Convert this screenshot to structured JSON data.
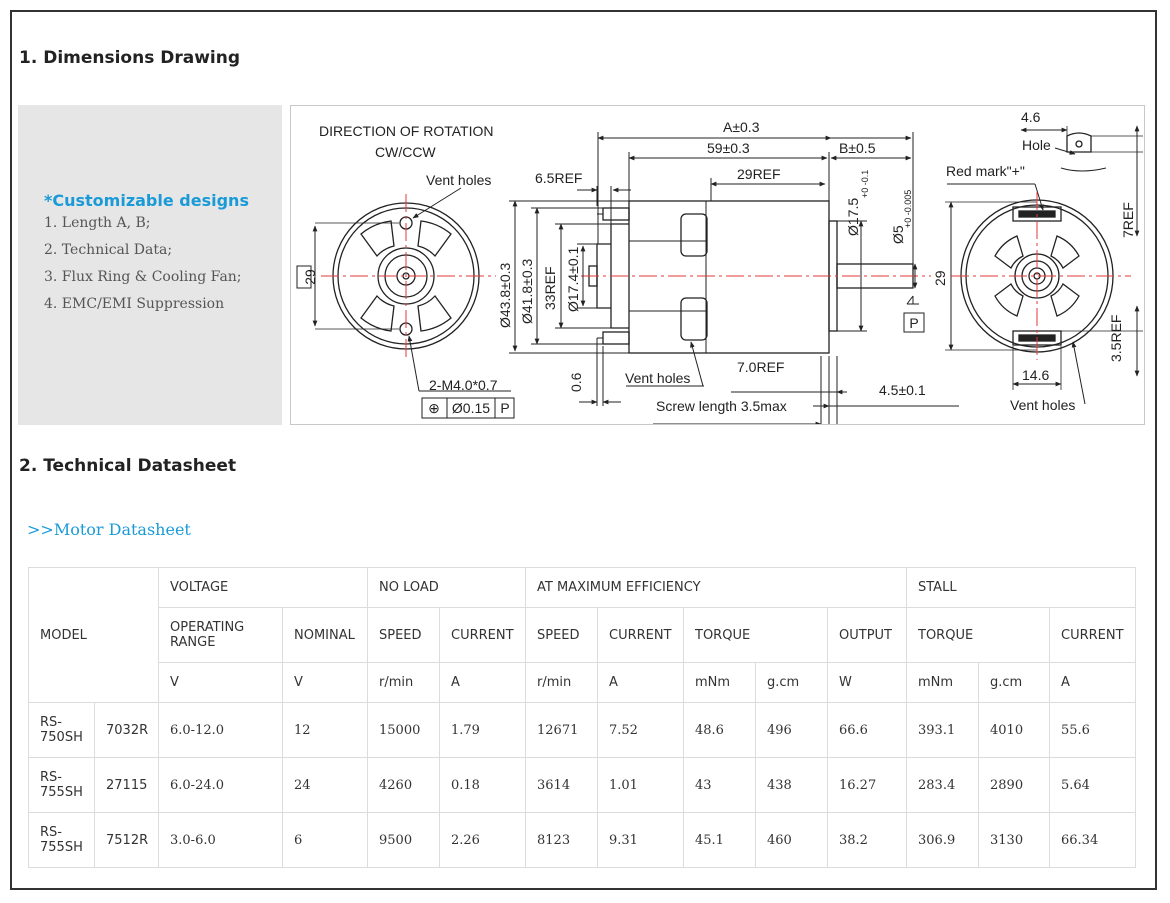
{
  "section1": {
    "title": "1. Dimensions Drawing"
  },
  "customizable": {
    "title": "*Customizable designs",
    "items": [
      "1. Length A, B;",
      "2. Technical Data;",
      "3. Flux Ring & Cooling Fan;",
      "4. EMC/EMI Suppression"
    ]
  },
  "drawing": {
    "direction_title": "DIRECTION OF ROTATION",
    "direction_value": "CW/CCW",
    "vent_holes_left": "Vent holes",
    "dim_29_left": "29",
    "mount_holes": "2-M4.0*0.7",
    "tol_symbol": "⊕",
    "tol_value": "Ø0.15",
    "tol_datum": "P",
    "dim_A": "A±0.3",
    "dim_59": "59±0.3",
    "dim_B": "B±0.5",
    "dim_6_5ref": "6.5REF",
    "dim_29ref": "29REF",
    "dim_43_8": "Ø43.8±0.3",
    "dim_41_8": "Ø41.8±0.3",
    "dim_33ref": "33REF",
    "dim_17_4": "Ø17.4±0.1",
    "dim_17_5": "Ø17.5",
    "dim_17_5_tol": "+0 -0.1",
    "dim_5": "Ø5",
    "dim_5_tol": "+0 -0.005",
    "datum_P": "P",
    "dim_0_6": "0.6",
    "vent_holes_mid": "Vent holes",
    "dim_7ref": "7.0REF",
    "screw_length": "Screw length 3.5max",
    "dim_4_5": "4.5±0.1",
    "dim_4_6": "4.6",
    "hole": "Hole",
    "red_mark": "Red mark\"+\"",
    "dim_7ref_right": "7REF",
    "dim_29_right": "29",
    "dim_3_5ref": "3.5REF",
    "dim_14_6": "14.6",
    "vent_holes_right": "Vent holes"
  },
  "section2": {
    "title": "2. Technical Datasheet"
  },
  "datasheet_link": ">>Motor Datasheet",
  "table": {
    "model": "MODEL",
    "voltage": "VOLTAGE",
    "no_load": "NO LOAD",
    "max_eff": "AT MAXIMUM EFFICIENCY",
    "stall": "STALL",
    "operating_range": "OPERATING RANGE",
    "nominal": "NOMINAL",
    "speed": "SPEED",
    "current": "CURRENT",
    "torque": "TORQUE",
    "output": "OUTPUT",
    "units": {
      "v1": "V",
      "v2": "V",
      "rpm1": "r/min",
      "a1": "A",
      "rpm2": "r/min",
      "a2": "A",
      "mnm1": "mNm",
      "gcm1": "g.cm",
      "w": "W",
      "mnm2": "mNm",
      "gcm2": "g.cm",
      "a3": "A"
    },
    "rows": [
      [
        "RS-750SH",
        "7032R",
        "6.0-12.0",
        "12",
        "15000",
        "1.79",
        "12671",
        "7.52",
        "48.6",
        "496",
        "66.6",
        "393.1",
        "4010",
        "55.6"
      ],
      [
        "RS-755SH",
        "27115",
        "6.0-24.0",
        "24",
        "4260",
        "0.18",
        "3614",
        "1.01",
        "43",
        "438",
        "16.27",
        "283.4",
        "2890",
        "5.64"
      ],
      [
        "RS-755SH",
        "7512R",
        "3.0-6.0",
        "6",
        "9500",
        "2.26",
        "8123",
        "9.31",
        "45.1",
        "460",
        "38.2",
        "306.9",
        "3130",
        "66.34"
      ]
    ]
  }
}
